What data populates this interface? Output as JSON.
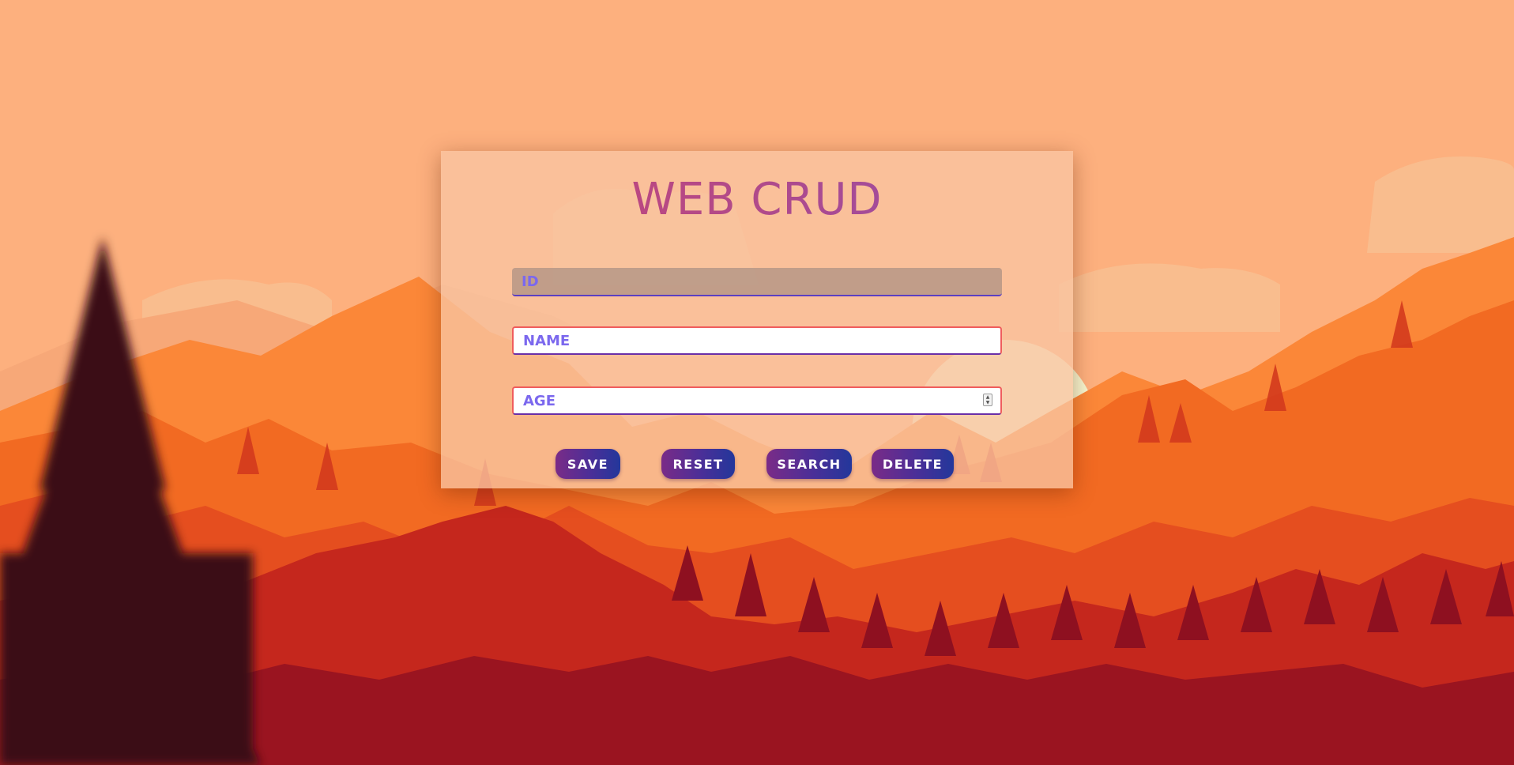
{
  "app": {
    "title": "WEB CRUD"
  },
  "form": {
    "id_placeholder": "ID",
    "name_placeholder": "NAME",
    "age_placeholder": "AGE",
    "id_value": "",
    "name_value": "",
    "age_value": ""
  },
  "buttons": {
    "save": "SAVE",
    "reset": "RESET",
    "search": "SEARCH",
    "delete": "DELETE"
  },
  "colors": {
    "sky": "#fdb07e",
    "sun": "#f6f6cf",
    "accent": "#7b68ee",
    "button_start": "#7a2b87",
    "button_end": "#23379b",
    "title_start": "#c94475",
    "title_end": "#8f4db0"
  }
}
